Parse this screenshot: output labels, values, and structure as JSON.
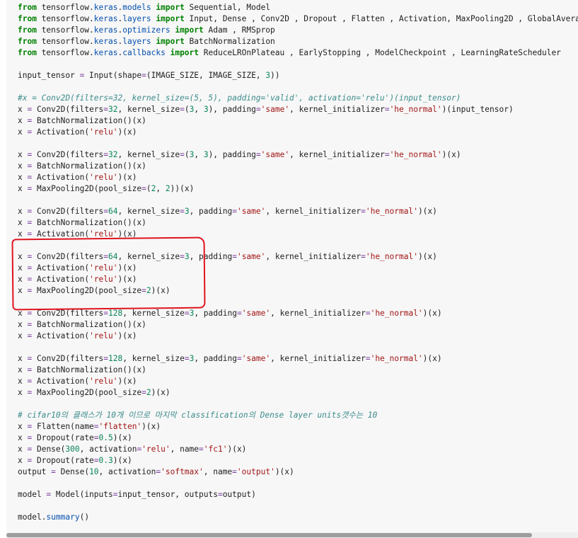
{
  "code_lines": [
    [
      {
        "t": "from",
        "c": "kw"
      },
      {
        "t": " tensorflow.",
        "c": ""
      },
      {
        "t": "keras",
        "c": "mod"
      },
      {
        "t": ".",
        "c": ""
      },
      {
        "t": "models",
        "c": "mod"
      },
      {
        "t": " ",
        "c": ""
      },
      {
        "t": "import",
        "c": "kw"
      },
      {
        "t": " Sequential, Model",
        "c": ""
      }
    ],
    [
      {
        "t": "from",
        "c": "kw"
      },
      {
        "t": " tensorflow.",
        "c": ""
      },
      {
        "t": "keras",
        "c": "mod"
      },
      {
        "t": ".",
        "c": ""
      },
      {
        "t": "layers",
        "c": "mod"
      },
      {
        "t": " ",
        "c": ""
      },
      {
        "t": "import",
        "c": "kw"
      },
      {
        "t": " Input, Dense , Conv2D , Dropout , Flatten , Activation, MaxPooling2D , GlobalAvera",
        "c": ""
      }
    ],
    [
      {
        "t": "from",
        "c": "kw"
      },
      {
        "t": " tensorflow.",
        "c": ""
      },
      {
        "t": "keras",
        "c": "mod"
      },
      {
        "t": ".",
        "c": ""
      },
      {
        "t": "optimizers",
        "c": "mod"
      },
      {
        "t": " ",
        "c": ""
      },
      {
        "t": "import",
        "c": "kw"
      },
      {
        "t": " Adam , RMSprop",
        "c": ""
      }
    ],
    [
      {
        "t": "from",
        "c": "kw"
      },
      {
        "t": " tensorflow.",
        "c": ""
      },
      {
        "t": "keras",
        "c": "mod"
      },
      {
        "t": ".",
        "c": ""
      },
      {
        "t": "layers",
        "c": "mod"
      },
      {
        "t": " ",
        "c": ""
      },
      {
        "t": "import",
        "c": "kw"
      },
      {
        "t": " BatchNormalization",
        "c": ""
      }
    ],
    [
      {
        "t": "from",
        "c": "kw"
      },
      {
        "t": " tensorflow.",
        "c": ""
      },
      {
        "t": "keras",
        "c": "mod"
      },
      {
        "t": ".",
        "c": ""
      },
      {
        "t": "callbacks",
        "c": "mod"
      },
      {
        "t": " ",
        "c": ""
      },
      {
        "t": "import",
        "c": "kw"
      },
      {
        "t": " ReduceLROnPlateau , EarlyStopping , ModelCheckpoint , LearningRateScheduler",
        "c": ""
      }
    ],
    [],
    [
      {
        "t": "input_tensor ",
        "c": ""
      },
      {
        "t": "=",
        "c": "op"
      },
      {
        "t": " Input(shape",
        "c": ""
      },
      {
        "t": "=",
        "c": "op"
      },
      {
        "t": "(IMAGE_SIZE, IMAGE_SIZE, ",
        "c": ""
      },
      {
        "t": "3",
        "c": "num"
      },
      {
        "t": "))",
        "c": ""
      }
    ],
    [],
    [
      {
        "t": "#x = Conv2D(filters=32, kernel_size=(5, 5), padding='valid', activation='relu')(input_tensor)",
        "c": "cm"
      }
    ],
    [
      {
        "t": "x ",
        "c": ""
      },
      {
        "t": "=",
        "c": "op"
      },
      {
        "t": " Conv2D(filters",
        "c": ""
      },
      {
        "t": "=",
        "c": "op"
      },
      {
        "t": "32",
        "c": "num"
      },
      {
        "t": ", kernel_size",
        "c": ""
      },
      {
        "t": "=",
        "c": "op"
      },
      {
        "t": "(",
        "c": ""
      },
      {
        "t": "3",
        "c": "num"
      },
      {
        "t": ", ",
        "c": ""
      },
      {
        "t": "3",
        "c": "num"
      },
      {
        "t": "), padding",
        "c": ""
      },
      {
        "t": "=",
        "c": "op"
      },
      {
        "t": "'same'",
        "c": "str"
      },
      {
        "t": ", kernel_initializer",
        "c": ""
      },
      {
        "t": "=",
        "c": "op"
      },
      {
        "t": "'he_normal'",
        "c": "str"
      },
      {
        "t": ")(input_tensor)",
        "c": ""
      }
    ],
    [
      {
        "t": "x ",
        "c": ""
      },
      {
        "t": "=",
        "c": "op"
      },
      {
        "t": " BatchNormalization()(x)",
        "c": ""
      }
    ],
    [
      {
        "t": "x ",
        "c": ""
      },
      {
        "t": "=",
        "c": "op"
      },
      {
        "t": " Activation(",
        "c": ""
      },
      {
        "t": "'relu'",
        "c": "str"
      },
      {
        "t": ")(x)",
        "c": ""
      }
    ],
    [],
    [
      {
        "t": "x ",
        "c": ""
      },
      {
        "t": "=",
        "c": "op"
      },
      {
        "t": " Conv2D(filters",
        "c": ""
      },
      {
        "t": "=",
        "c": "op"
      },
      {
        "t": "32",
        "c": "num"
      },
      {
        "t": ", kernel_size",
        "c": ""
      },
      {
        "t": "=",
        "c": "op"
      },
      {
        "t": "(",
        "c": ""
      },
      {
        "t": "3",
        "c": "num"
      },
      {
        "t": ", ",
        "c": ""
      },
      {
        "t": "3",
        "c": "num"
      },
      {
        "t": "), padding",
        "c": ""
      },
      {
        "t": "=",
        "c": "op"
      },
      {
        "t": "'same'",
        "c": "str"
      },
      {
        "t": ", kernel_initializer",
        "c": ""
      },
      {
        "t": "=",
        "c": "op"
      },
      {
        "t": "'he_normal'",
        "c": "str"
      },
      {
        "t": ")(x)",
        "c": ""
      }
    ],
    [
      {
        "t": "x ",
        "c": ""
      },
      {
        "t": "=",
        "c": "op"
      },
      {
        "t": " BatchNormalization()(x)",
        "c": ""
      }
    ],
    [
      {
        "t": "x ",
        "c": ""
      },
      {
        "t": "=",
        "c": "op"
      },
      {
        "t": " Activation(",
        "c": ""
      },
      {
        "t": "'relu'",
        "c": "str"
      },
      {
        "t": ")(x)",
        "c": ""
      }
    ],
    [
      {
        "t": "x ",
        "c": ""
      },
      {
        "t": "=",
        "c": "op"
      },
      {
        "t": " MaxPooling2D(pool_size",
        "c": ""
      },
      {
        "t": "=",
        "c": "op"
      },
      {
        "t": "(",
        "c": ""
      },
      {
        "t": "2",
        "c": "num"
      },
      {
        "t": ", ",
        "c": ""
      },
      {
        "t": "2",
        "c": "num"
      },
      {
        "t": "))(x)",
        "c": ""
      }
    ],
    [],
    [
      {
        "t": "x ",
        "c": ""
      },
      {
        "t": "=",
        "c": "op"
      },
      {
        "t": " Conv2D(filters",
        "c": ""
      },
      {
        "t": "=",
        "c": "op"
      },
      {
        "t": "64",
        "c": "num"
      },
      {
        "t": ", kernel_size",
        "c": ""
      },
      {
        "t": "=",
        "c": "op"
      },
      {
        "t": "3",
        "c": "num"
      },
      {
        "t": ", padding",
        "c": ""
      },
      {
        "t": "=",
        "c": "op"
      },
      {
        "t": "'same'",
        "c": "str"
      },
      {
        "t": ", kernel_initializer",
        "c": ""
      },
      {
        "t": "=",
        "c": "op"
      },
      {
        "t": "'he_normal'",
        "c": "str"
      },
      {
        "t": ")(x)",
        "c": ""
      }
    ],
    [
      {
        "t": "x ",
        "c": ""
      },
      {
        "t": "=",
        "c": "op"
      },
      {
        "t": " BatchNormalization()(x)",
        "c": ""
      }
    ],
    [
      {
        "t": "x ",
        "c": ""
      },
      {
        "t": "=",
        "c": "op"
      },
      {
        "t": " Activation(",
        "c": ""
      },
      {
        "t": "'relu'",
        "c": "str"
      },
      {
        "t": ")(x)",
        "c": ""
      }
    ],
    [],
    [
      {
        "t": "x ",
        "c": ""
      },
      {
        "t": "=",
        "c": "op"
      },
      {
        "t": " Conv2D(filters",
        "c": ""
      },
      {
        "t": "=",
        "c": "op"
      },
      {
        "t": "64",
        "c": "num"
      },
      {
        "t": ", kernel_size",
        "c": ""
      },
      {
        "t": "=",
        "c": "op"
      },
      {
        "t": "3",
        "c": "num"
      },
      {
        "t": ", padding",
        "c": ""
      },
      {
        "t": "=",
        "c": "op"
      },
      {
        "t": "'same'",
        "c": "str"
      },
      {
        "t": ", kernel_initializer",
        "c": ""
      },
      {
        "t": "=",
        "c": "op"
      },
      {
        "t": "'he_normal'",
        "c": "str"
      },
      {
        "t": ")(x)",
        "c": ""
      }
    ],
    [
      {
        "t": "x ",
        "c": ""
      },
      {
        "t": "=",
        "c": "op"
      },
      {
        "t": " Activation(",
        "c": ""
      },
      {
        "t": "'relu'",
        "c": "str"
      },
      {
        "t": ")(x)",
        "c": ""
      }
    ],
    [
      {
        "t": "x ",
        "c": ""
      },
      {
        "t": "=",
        "c": "op"
      },
      {
        "t": " Activation(",
        "c": ""
      },
      {
        "t": "'relu'",
        "c": "str"
      },
      {
        "t": ")(x)",
        "c": ""
      }
    ],
    [
      {
        "t": "x ",
        "c": ""
      },
      {
        "t": "=",
        "c": "op"
      },
      {
        "t": " MaxPooling2D(pool_size",
        "c": ""
      },
      {
        "t": "=",
        "c": "op"
      },
      {
        "t": "2",
        "c": "num"
      },
      {
        "t": ")(x)",
        "c": ""
      }
    ],
    [],
    [
      {
        "t": "x ",
        "c": ""
      },
      {
        "t": "=",
        "c": "op"
      },
      {
        "t": " Conv2D(filters",
        "c": ""
      },
      {
        "t": "=",
        "c": "op"
      },
      {
        "t": "128",
        "c": "num"
      },
      {
        "t": ", kernel_size",
        "c": ""
      },
      {
        "t": "=",
        "c": "op"
      },
      {
        "t": "3",
        "c": "num"
      },
      {
        "t": ", padding",
        "c": ""
      },
      {
        "t": "=",
        "c": "op"
      },
      {
        "t": "'same'",
        "c": "str"
      },
      {
        "t": ", kernel_initializer",
        "c": ""
      },
      {
        "t": "=",
        "c": "op"
      },
      {
        "t": "'he_normal'",
        "c": "str"
      },
      {
        "t": ")(x)",
        "c": ""
      }
    ],
    [
      {
        "t": "x ",
        "c": ""
      },
      {
        "t": "=",
        "c": "op"
      },
      {
        "t": " BatchNormalization()(x)",
        "c": ""
      }
    ],
    [
      {
        "t": "x ",
        "c": ""
      },
      {
        "t": "=",
        "c": "op"
      },
      {
        "t": " Activation(",
        "c": ""
      },
      {
        "t": "'relu'",
        "c": "str"
      },
      {
        "t": ")(x)",
        "c": ""
      }
    ],
    [],
    [
      {
        "t": "x ",
        "c": ""
      },
      {
        "t": "=",
        "c": "op"
      },
      {
        "t": " Conv2D(filters",
        "c": ""
      },
      {
        "t": "=",
        "c": "op"
      },
      {
        "t": "128",
        "c": "num"
      },
      {
        "t": ", kernel_size",
        "c": ""
      },
      {
        "t": "=",
        "c": "op"
      },
      {
        "t": "3",
        "c": "num"
      },
      {
        "t": ", padding",
        "c": ""
      },
      {
        "t": "=",
        "c": "op"
      },
      {
        "t": "'same'",
        "c": "str"
      },
      {
        "t": ", kernel_initializer",
        "c": ""
      },
      {
        "t": "=",
        "c": "op"
      },
      {
        "t": "'he_normal'",
        "c": "str"
      },
      {
        "t": ")(x)",
        "c": ""
      }
    ],
    [
      {
        "t": "x ",
        "c": ""
      },
      {
        "t": "=",
        "c": "op"
      },
      {
        "t": " BatchNormalization()(x)",
        "c": ""
      }
    ],
    [
      {
        "t": "x ",
        "c": ""
      },
      {
        "t": "=",
        "c": "op"
      },
      {
        "t": " Activation(",
        "c": ""
      },
      {
        "t": "'relu'",
        "c": "str"
      },
      {
        "t": ")(x)",
        "c": ""
      }
    ],
    [
      {
        "t": "x ",
        "c": ""
      },
      {
        "t": "=",
        "c": "op"
      },
      {
        "t": " MaxPooling2D(pool_size",
        "c": ""
      },
      {
        "t": "=",
        "c": "op"
      },
      {
        "t": "2",
        "c": "num"
      },
      {
        "t": ")(x)",
        "c": ""
      }
    ],
    [],
    [
      {
        "t": "# cifar10의 클래스가 10개 이므로 마지막 classification의 Dense layer units갯수는 10",
        "c": "cm"
      }
    ],
    [
      {
        "t": "x ",
        "c": ""
      },
      {
        "t": "=",
        "c": "op"
      },
      {
        "t": " Flatten(name",
        "c": ""
      },
      {
        "t": "=",
        "c": "op"
      },
      {
        "t": "'flatten'",
        "c": "str"
      },
      {
        "t": ")(x)",
        "c": ""
      }
    ],
    [
      {
        "t": "x ",
        "c": ""
      },
      {
        "t": "=",
        "c": "op"
      },
      {
        "t": " Dropout(rate",
        "c": ""
      },
      {
        "t": "=",
        "c": "op"
      },
      {
        "t": "0.5",
        "c": "num"
      },
      {
        "t": ")(x)",
        "c": ""
      }
    ],
    [
      {
        "t": "x ",
        "c": ""
      },
      {
        "t": "=",
        "c": "op"
      },
      {
        "t": " Dense(",
        "c": ""
      },
      {
        "t": "300",
        "c": "num"
      },
      {
        "t": ", activation",
        "c": ""
      },
      {
        "t": "=",
        "c": "op"
      },
      {
        "t": "'relu'",
        "c": "str"
      },
      {
        "t": ", name",
        "c": ""
      },
      {
        "t": "=",
        "c": "op"
      },
      {
        "t": "'fc1'",
        "c": "str"
      },
      {
        "t": ")(x)",
        "c": ""
      }
    ],
    [
      {
        "t": "x ",
        "c": ""
      },
      {
        "t": "=",
        "c": "op"
      },
      {
        "t": " Dropout(rate",
        "c": ""
      },
      {
        "t": "=",
        "c": "op"
      },
      {
        "t": "0.3",
        "c": "num"
      },
      {
        "t": ")(x)",
        "c": ""
      }
    ],
    [
      {
        "t": "output ",
        "c": ""
      },
      {
        "t": "=",
        "c": "op"
      },
      {
        "t": " Dense(",
        "c": ""
      },
      {
        "t": "10",
        "c": "num"
      },
      {
        "t": ", activation",
        "c": ""
      },
      {
        "t": "=",
        "c": "op"
      },
      {
        "t": "'softmax'",
        "c": "str"
      },
      {
        "t": ", name",
        "c": ""
      },
      {
        "t": "=",
        "c": "op"
      },
      {
        "t": "'output'",
        "c": "str"
      },
      {
        "t": ")(x)",
        "c": ""
      }
    ],
    [],
    [
      {
        "t": "model ",
        "c": ""
      },
      {
        "t": "=",
        "c": "op"
      },
      {
        "t": " Model(inputs",
        "c": ""
      },
      {
        "t": "=",
        "c": "op"
      },
      {
        "t": "input_tensor, outputs",
        "c": ""
      },
      {
        "t": "=",
        "c": "op"
      },
      {
        "t": "output)",
        "c": ""
      }
    ],
    [],
    [
      {
        "t": "model.",
        "c": ""
      },
      {
        "t": "summary",
        "c": "fn"
      },
      {
        "t": "()",
        "c": ""
      }
    ]
  ],
  "colors": {
    "keyword": "#008000",
    "string": "#a31515",
    "number": "#098658",
    "comment": "#3d8b8b",
    "annotation": "#e0141e"
  },
  "scrollbar": {
    "horizontal_position": 0.0,
    "visible_fraction": 0.92
  }
}
